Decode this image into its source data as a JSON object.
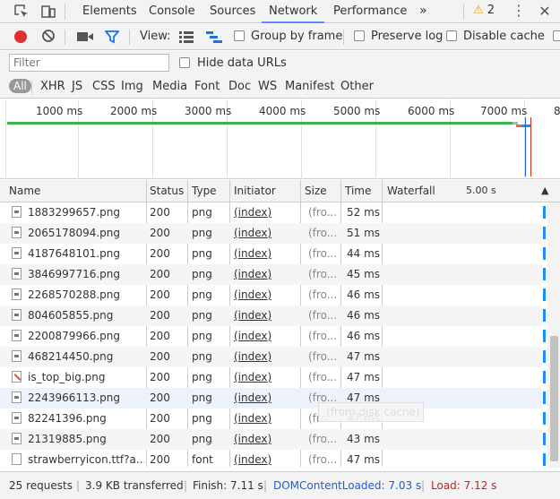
{
  "tabs": [
    {
      "label": "Elements"
    },
    {
      "label": "Console"
    },
    {
      "label": "Sources"
    },
    {
      "label": "Network"
    },
    {
      "label": "Performance"
    }
  ],
  "more_tabs": "»",
  "warning_count": "2",
  "toolbar": {
    "view_label": "View:",
    "group_by_frame": "Group by frame",
    "preserve_log": "Preserve log",
    "disable_cache": "Disable cache"
  },
  "filter": {
    "placeholder": "Filter",
    "hide_data_urls": "Hide data URLs"
  },
  "types": [
    "All",
    "XHR",
    "JS",
    "CSS",
    "Img",
    "Media",
    "Font",
    "Doc",
    "WS",
    "Manifest",
    "Other"
  ],
  "overview_ticks": [
    "1000 ms",
    "2000 ms",
    "3000 ms",
    "4000 ms",
    "5000 ms",
    "6000 ms",
    "7000 ms",
    "8"
  ],
  "columns": {
    "name": "Name",
    "status": "Status",
    "type": "Type",
    "initiator": "Initiator",
    "size": "Size",
    "time": "Time",
    "waterfall": "Waterfall",
    "waterfall_time": "5.00 s"
  },
  "rows": [
    {
      "name": "1883299657.png",
      "status": "200",
      "type": "png",
      "initiator": "(index)",
      "size": "(fro...",
      "time": "52 ms",
      "icon": "image-file-icon"
    },
    {
      "name": "2065178094.png",
      "status": "200",
      "type": "png",
      "initiator": "(index)",
      "size": "(fro...",
      "time": "51 ms",
      "icon": "image-file-icon"
    },
    {
      "name": "4187648101.png",
      "status": "200",
      "type": "png",
      "initiator": "(index)",
      "size": "(fro...",
      "time": "44 ms",
      "icon": "image-file-icon"
    },
    {
      "name": "3846997716.png",
      "status": "200",
      "type": "png",
      "initiator": "(index)",
      "size": "(fro...",
      "time": "45 ms",
      "icon": "image-file-icon"
    },
    {
      "name": "2268570288.png",
      "status": "200",
      "type": "png",
      "initiator": "(index)",
      "size": "(fro...",
      "time": "46 ms",
      "icon": "image-file-icon"
    },
    {
      "name": "804605855.png",
      "status": "200",
      "type": "png",
      "initiator": "(index)",
      "size": "(fro...",
      "time": "46 ms",
      "icon": "image-file-icon"
    },
    {
      "name": "2200879966.png",
      "status": "200",
      "type": "png",
      "initiator": "(index)",
      "size": "(fro...",
      "time": "46 ms",
      "icon": "image-file-icon"
    },
    {
      "name": "468214450.png",
      "status": "200",
      "type": "png",
      "initiator": "(index)",
      "size": "(fro...",
      "time": "47 ms",
      "icon": "image-file-icon"
    },
    {
      "name": "is_top_big.png",
      "status": "200",
      "type": "png",
      "initiator": "(index)",
      "size": "(fro...",
      "time": "47 ms",
      "icon": "image-file-icon"
    },
    {
      "name": "2243966113.png",
      "status": "200",
      "type": "png",
      "initiator": "(index)",
      "size": "(fro...",
      "time": "47 ms",
      "icon": "image-file-icon"
    },
    {
      "name": "82241396.png",
      "status": "200",
      "type": "png",
      "initiator": "(index)",
      "size": "(fro...",
      "time": "47 ms",
      "icon": "image-file-icon"
    },
    {
      "name": "21319885.png",
      "status": "200",
      "type": "png",
      "initiator": "(index)",
      "size": "(fro...",
      "time": "43 ms",
      "icon": "image-file-icon"
    },
    {
      "name": "strawberryicon.ttf?a...",
      "status": "200",
      "type": "font",
      "initiator": "(index)",
      "size": "(fro...",
      "time": "47 ms",
      "icon": "font-file-icon"
    }
  ],
  "tooltip": "(from disk cache)",
  "status_bar": {
    "requests": "25 requests",
    "transferred": "3.9 KB transferred",
    "finish": "Finish: 7.11 s",
    "dom_content_loaded": "DOMContentLoaded: 7.03 s",
    "load": "Load: 7.12 s"
  },
  "colors": {
    "accent": "#5a87ff",
    "record": "#e03030",
    "dcl": "#1a5fd6",
    "load": "#c5221f"
  }
}
